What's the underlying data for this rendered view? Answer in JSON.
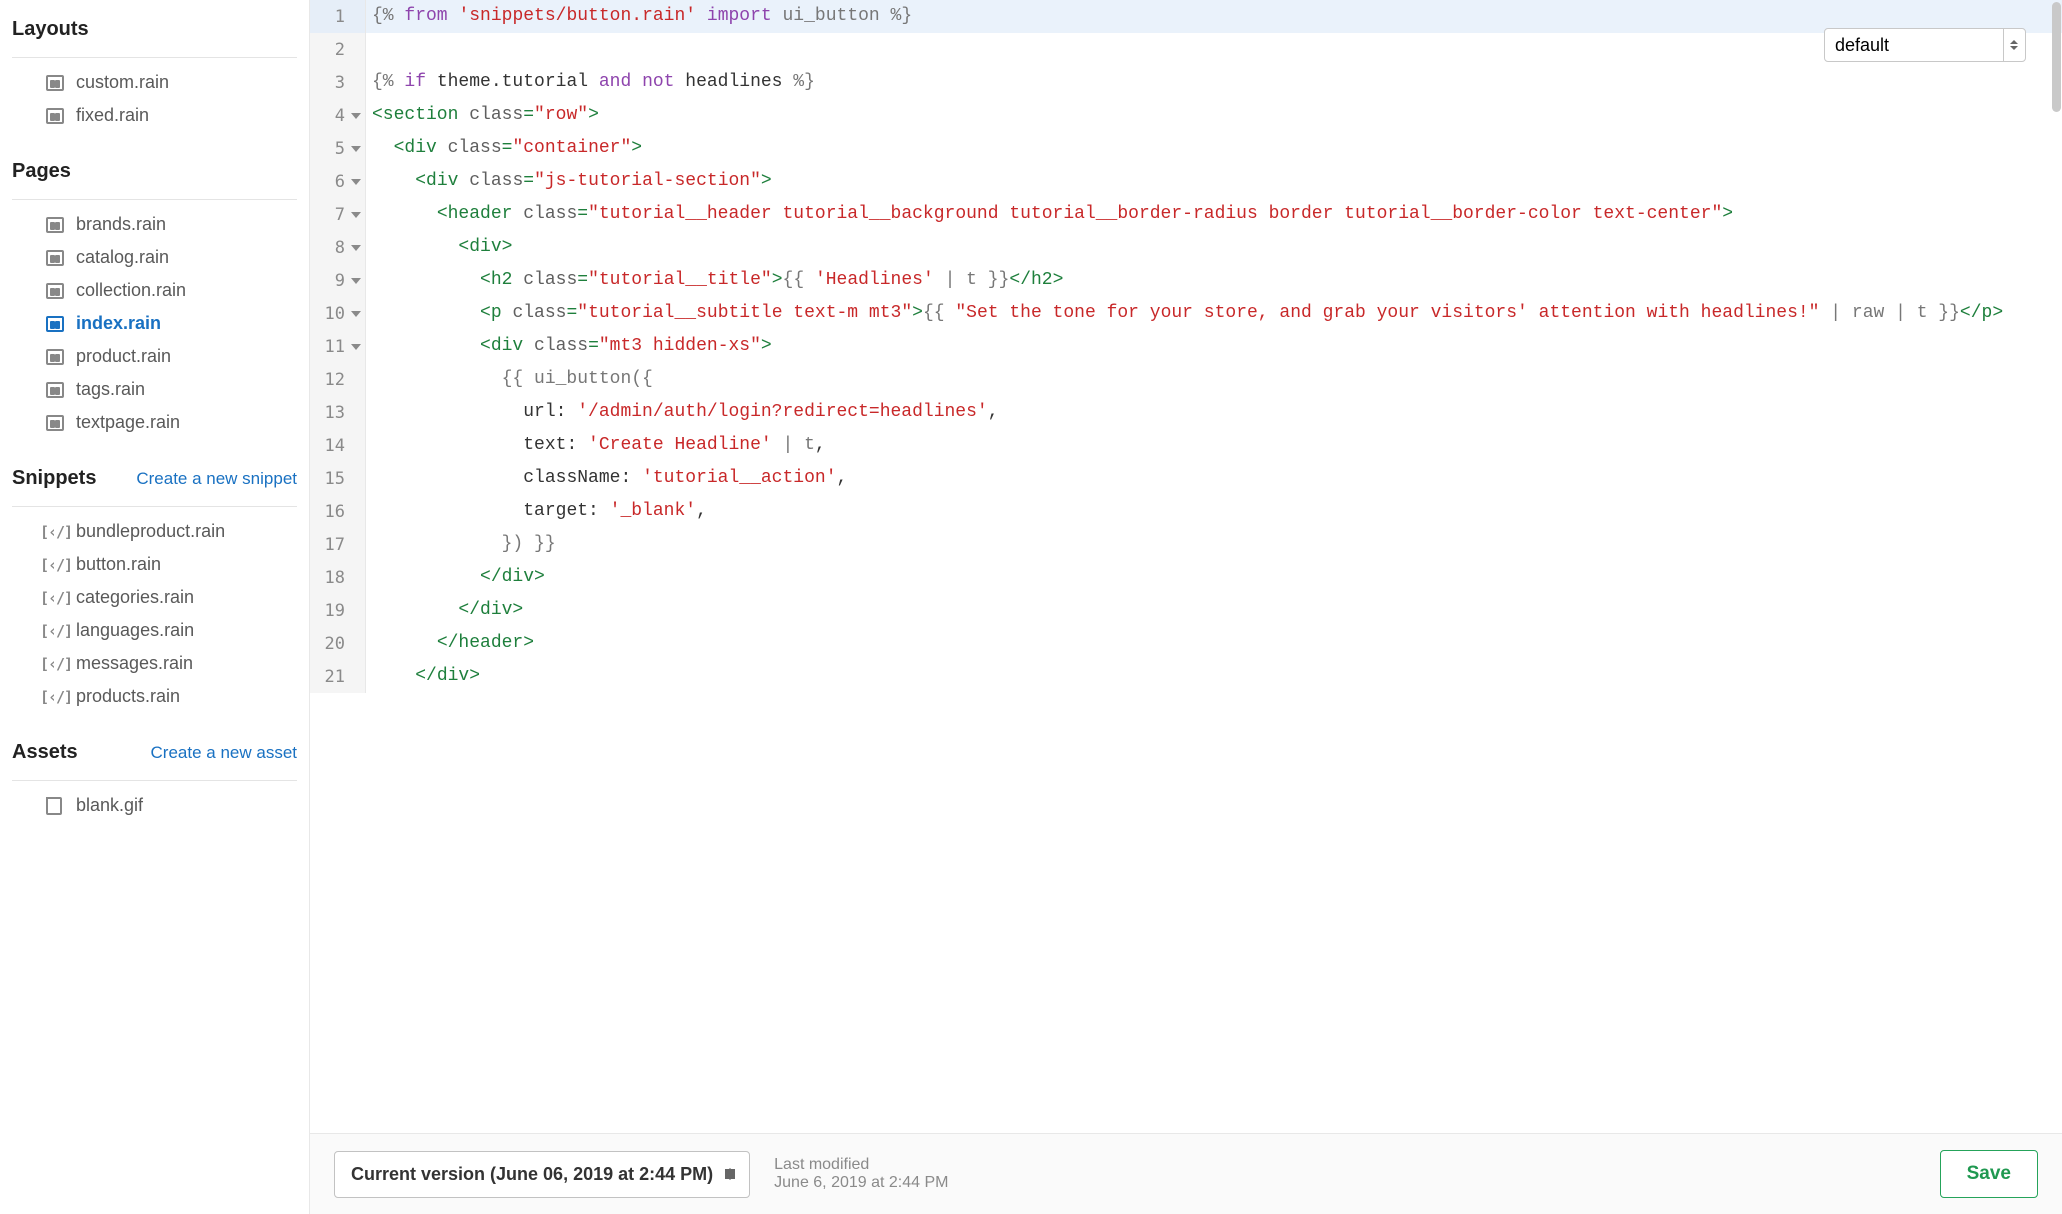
{
  "sidebar": {
    "sections": [
      {
        "title": "Layouts",
        "link": null,
        "icon": "layout",
        "items": [
          "custom.rain",
          "fixed.rain"
        ]
      },
      {
        "title": "Pages",
        "link": null,
        "icon": "layout",
        "items": [
          "brands.rain",
          "catalog.rain",
          "collection.rain",
          "index.rain",
          "product.rain",
          "tags.rain",
          "textpage.rain"
        ],
        "active": "index.rain"
      },
      {
        "title": "Snippets",
        "link": "Create a new snippet",
        "icon": "snippet",
        "items": [
          "bundleproduct.rain",
          "button.rain",
          "categories.rain",
          "languages.rain",
          "messages.rain",
          "products.rain"
        ]
      },
      {
        "title": "Assets",
        "link": "Create a new asset",
        "icon": "asset",
        "items": [
          "blank.gif"
        ]
      }
    ]
  },
  "dropdown": {
    "selected": "default"
  },
  "code": {
    "lines": [
      {
        "n": 1,
        "hl": true,
        "folded": false,
        "tokens": [
          [
            "twig",
            "{% "
          ],
          [
            "kw",
            "from"
          ],
          [
            "twig",
            " "
          ],
          [
            "str",
            "'snippets/button.rain'"
          ],
          [
            "twig",
            " "
          ],
          [
            "kw",
            "import"
          ],
          [
            "twig",
            " ui_button %}"
          ]
        ]
      },
      {
        "n": 2,
        "tokens": []
      },
      {
        "n": 3,
        "tokens": [
          [
            "twig",
            "{% "
          ],
          [
            "kw",
            "if"
          ],
          [
            "plain",
            " theme.tutorial "
          ],
          [
            "kw",
            "and"
          ],
          [
            "plain",
            " "
          ],
          [
            "kw",
            "not"
          ],
          [
            "plain",
            " headlines "
          ],
          [
            "twig",
            "%}"
          ]
        ]
      },
      {
        "n": 4,
        "folded": true,
        "tokens": [
          [
            "tag",
            "<section "
          ],
          [
            "attr",
            "class"
          ],
          [
            "tag",
            "="
          ],
          [
            "attrval",
            "\"row\""
          ],
          [
            "tag",
            ">"
          ]
        ]
      },
      {
        "n": 5,
        "folded": true,
        "tokens": [
          [
            "plain",
            "  "
          ],
          [
            "tag",
            "<div "
          ],
          [
            "attr",
            "class"
          ],
          [
            "tag",
            "="
          ],
          [
            "attrval",
            "\"container\""
          ],
          [
            "tag",
            ">"
          ]
        ]
      },
      {
        "n": 6,
        "folded": true,
        "tokens": [
          [
            "plain",
            "    "
          ],
          [
            "tag",
            "<div "
          ],
          [
            "attr",
            "class"
          ],
          [
            "tag",
            "="
          ],
          [
            "attrval",
            "\"js-tutorial-section\""
          ],
          [
            "tag",
            ">"
          ]
        ]
      },
      {
        "n": 7,
        "folded": true,
        "wrap": true,
        "tokens": [
          [
            "plain",
            "      "
          ],
          [
            "tag",
            "<header "
          ],
          [
            "attr",
            "class"
          ],
          [
            "tag",
            "="
          ],
          [
            "attrval",
            "\"tutorial__header tutorial__background tutorial__border-radius border tutorial__border-color text-center\""
          ],
          [
            "tag",
            ">"
          ]
        ]
      },
      {
        "n": 8,
        "folded": true,
        "tokens": [
          [
            "plain",
            "        "
          ],
          [
            "tag",
            "<div>"
          ]
        ]
      },
      {
        "n": 9,
        "folded": true,
        "tokens": [
          [
            "plain",
            "          "
          ],
          [
            "tag",
            "<h2 "
          ],
          [
            "attr",
            "class"
          ],
          [
            "tag",
            "="
          ],
          [
            "attrval",
            "\"tutorial__title\""
          ],
          [
            "tag",
            ">"
          ],
          [
            "twig",
            "{{ "
          ],
          [
            "str",
            "'Headlines'"
          ],
          [
            "twig",
            " | t }}"
          ],
          [
            "tag",
            "</h2>"
          ]
        ]
      },
      {
        "n": 10,
        "folded": true,
        "wrap": true,
        "tokens": [
          [
            "plain",
            "          "
          ],
          [
            "tag",
            "<p "
          ],
          [
            "attr",
            "class"
          ],
          [
            "tag",
            "="
          ],
          [
            "attrval",
            "\"tutorial__subtitle text-m mt3\""
          ],
          [
            "tag",
            ">"
          ],
          [
            "twig",
            "{{ "
          ],
          [
            "str",
            "\"Set the tone for your store, and grab your visitors' attention with headlines!\""
          ],
          [
            "twig",
            " | raw | t }}"
          ],
          [
            "tag",
            "</p>"
          ]
        ]
      },
      {
        "n": 11,
        "folded": true,
        "tokens": [
          [
            "plain",
            "          "
          ],
          [
            "tag",
            "<div "
          ],
          [
            "attr",
            "class"
          ],
          [
            "tag",
            "="
          ],
          [
            "attrval",
            "\"mt3 hidden-xs\""
          ],
          [
            "tag",
            ">"
          ]
        ]
      },
      {
        "n": 12,
        "tokens": [
          [
            "plain",
            "            "
          ],
          [
            "twig",
            "{{ ui_button({"
          ]
        ]
      },
      {
        "n": 13,
        "tokens": [
          [
            "plain",
            "              "
          ],
          [
            "prop",
            "url: "
          ],
          [
            "str",
            "'/admin/auth/login?redirect=headlines'"
          ],
          [
            "plain",
            ","
          ]
        ]
      },
      {
        "n": 14,
        "tokens": [
          [
            "plain",
            "              "
          ],
          [
            "prop",
            "text: "
          ],
          [
            "str",
            "'Create Headline'"
          ],
          [
            "twig",
            " | t"
          ],
          [
            "plain",
            ","
          ]
        ]
      },
      {
        "n": 15,
        "tokens": [
          [
            "plain",
            "              "
          ],
          [
            "prop",
            "className: "
          ],
          [
            "str",
            "'tutorial__action'"
          ],
          [
            "plain",
            ","
          ]
        ]
      },
      {
        "n": 16,
        "tokens": [
          [
            "plain",
            "              "
          ],
          [
            "prop",
            "target: "
          ],
          [
            "str",
            "'_blank'"
          ],
          [
            "plain",
            ","
          ]
        ]
      },
      {
        "n": 17,
        "tokens": [
          [
            "plain",
            "            "
          ],
          [
            "twig",
            "}) }}"
          ]
        ]
      },
      {
        "n": 18,
        "tokens": [
          [
            "plain",
            "          "
          ],
          [
            "tag",
            "</div>"
          ]
        ]
      },
      {
        "n": 19,
        "tokens": [
          [
            "plain",
            "        "
          ],
          [
            "tag",
            "</div>"
          ]
        ]
      },
      {
        "n": 20,
        "tokens": [
          [
            "plain",
            "      "
          ],
          [
            "tag",
            "</header>"
          ]
        ]
      },
      {
        "n": 21,
        "tokens": [
          [
            "plain",
            "    "
          ],
          [
            "tag",
            "</div>"
          ]
        ]
      }
    ]
  },
  "footer": {
    "version_label": "Current version (June 06, 2019 at 2:44 PM)",
    "modified_label": "Last modified",
    "modified_date": "June 6, 2019 at 2:44 PM",
    "save_label": "Save"
  }
}
